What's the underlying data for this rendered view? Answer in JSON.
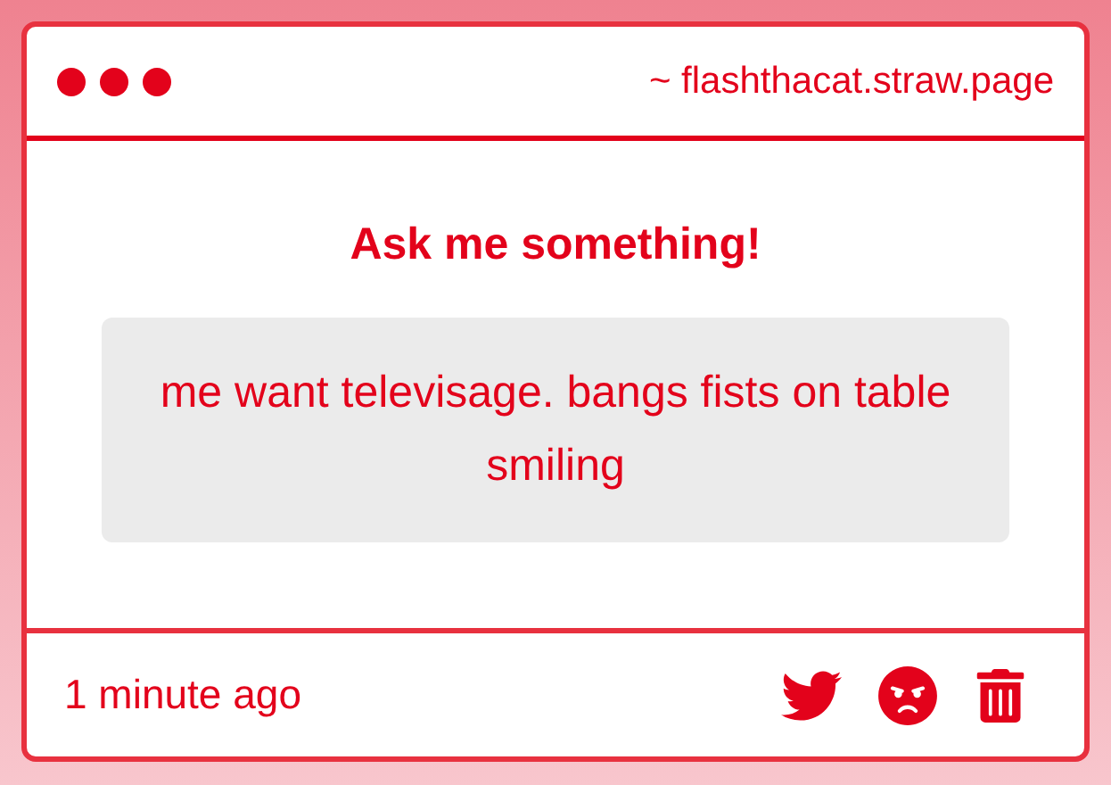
{
  "window": {
    "url": "~ flashthacat.straw.page"
  },
  "question": {
    "heading": "Ask me something!",
    "text": "me want televisage. bangs fists on table smiling"
  },
  "footer": {
    "time": "1 minute ago"
  }
}
